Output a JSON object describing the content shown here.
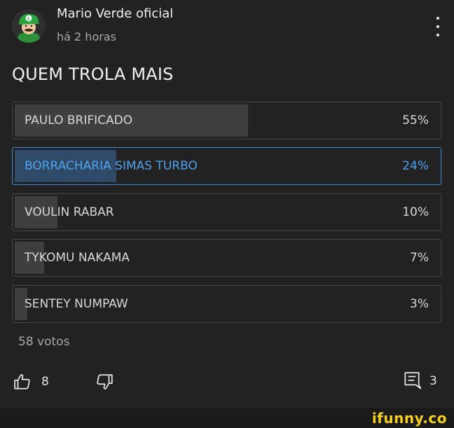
{
  "post": {
    "author": "Mario Verde oficial",
    "time": "há 2 horas",
    "question": "QUEM TROLA MAIS"
  },
  "poll": {
    "options": [
      {
        "label": "PAULO BRIFICADO",
        "percent_text": "55%",
        "percent": 55,
        "selected": false
      },
      {
        "label": "BORRACHARIA SIMAS TURBO",
        "percent_text": "24%",
        "percent": 24,
        "selected": true
      },
      {
        "label": "VOULIN RABAR",
        "percent_text": "10%",
        "percent": 10,
        "selected": false
      },
      {
        "label": "TYKOMU NAKAMA",
        "percent_text": "7%",
        "percent": 7,
        "selected": false
      },
      {
        "label": "SENTEY NUMPAW",
        "percent_text": "3%",
        "percent": 3,
        "selected": false
      }
    ],
    "votes": "58 votos"
  },
  "actions": {
    "like_icon": "thumbs-up-icon",
    "like_count": "8",
    "dislike_icon": "thumbs-down-icon",
    "comment_icon": "comment-icon",
    "comment_count": "3"
  },
  "watermark": "ifunny.co",
  "colors": {
    "background": "#222222",
    "accent": "#3e8ad4",
    "selected_text": "#4ea3f0",
    "watermark": "#f5cf21"
  }
}
